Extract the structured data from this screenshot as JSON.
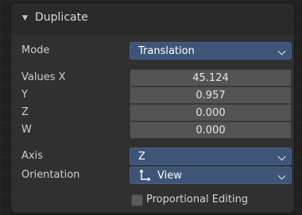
{
  "panel": {
    "title": "Duplicate",
    "collapse_icon": "triangle-down-icon"
  },
  "mode": {
    "label": "Mode",
    "value": "Translation"
  },
  "values": {
    "x": {
      "label": "Values X",
      "value": "45.124"
    },
    "y": {
      "label": "Y",
      "value": "0.957"
    },
    "z": {
      "label": "Z",
      "value": "0.000"
    },
    "w": {
      "label": "W",
      "value": "0.000"
    }
  },
  "axis": {
    "label": "Axis",
    "value": "Z"
  },
  "orientation": {
    "label": "Orientation",
    "value": "View",
    "icon": "orientation-axes-icon"
  },
  "proportional_editing": {
    "label": "Proportional Editing",
    "checked": false
  },
  "colors": {
    "dropdown": "#3f5577",
    "panel": "#303030",
    "number_field": "#545454"
  }
}
